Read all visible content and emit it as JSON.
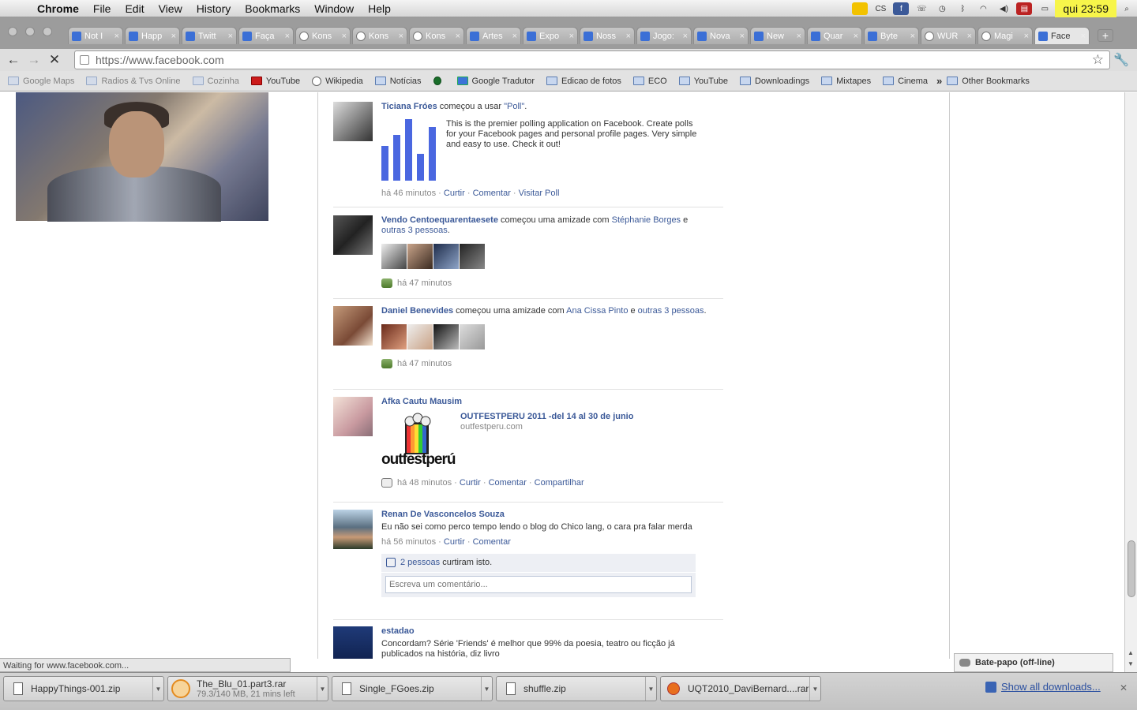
{
  "menubar": {
    "app": "Chrome",
    "items": [
      "File",
      "Edit",
      "View",
      "History",
      "Bookmarks",
      "Window",
      "Help"
    ],
    "tray_cs": "CS",
    "clock": "qui 23:59"
  },
  "tabs": [
    {
      "label": "Not I"
    },
    {
      "label": "Happ"
    },
    {
      "label": "Twitt"
    },
    {
      "label": "Faça"
    },
    {
      "label": "Kons"
    },
    {
      "label": "Kons"
    },
    {
      "label": "Kons"
    },
    {
      "label": "Artes"
    },
    {
      "label": "Expo"
    },
    {
      "label": "Noss"
    },
    {
      "label": "Jogo:"
    },
    {
      "label": "Nova"
    },
    {
      "label": "New"
    },
    {
      "label": "Quar"
    },
    {
      "label": "Byte"
    },
    {
      "label": "WUR"
    },
    {
      "label": "Magi"
    },
    {
      "label": "Face"
    }
  ],
  "address": "https://www.facebook.com",
  "bookmarks": [
    {
      "label": "Google Maps",
      "icon": "folder-icon"
    },
    {
      "label": "Radios & Tvs Online",
      "icon": "folder-icon"
    },
    {
      "label": "Cozinha",
      "icon": "folder-icon"
    },
    {
      "label": "YouTube",
      "icon": "youtube-icon"
    },
    {
      "label": "Wikipedia",
      "icon": "wikipedia-icon"
    },
    {
      "label": "Notícias",
      "icon": "folder-icon"
    },
    {
      "label": "",
      "icon": "spinner-icon"
    },
    {
      "label": "Google Tradutor",
      "icon": "translate-icon"
    },
    {
      "label": "Edicao de fotos",
      "icon": "folder-icon"
    },
    {
      "label": "ECO",
      "icon": "folder-icon"
    },
    {
      "label": "YouTube",
      "icon": "folder-icon"
    },
    {
      "label": "Downloadings",
      "icon": "folder-icon"
    },
    {
      "label": "Mixtapes",
      "icon": "folder-icon"
    },
    {
      "label": "Cinema",
      "icon": "folder-icon"
    }
  ],
  "other_bookmarks": "Other Bookmarks",
  "feed": {
    "s1": {
      "name": "Ticiana Fróes",
      "action": " começou a usar ",
      "app": "\"Poll\"",
      "desc": "This is the premier polling application on Facebook. Create polls for your Facebook pages and personal profile pages. Very simple and easy to use. Check it out!",
      "time": "há 46 minutos",
      "curtir": "Curtir",
      "comentar": "Comentar",
      "extra": "Visitar Poll",
      "sep": " · "
    },
    "s2": {
      "name": "Vendo Centoequarentaesete",
      "action": " começou uma amizade com ",
      "friend": "Stéphanie Borges",
      "and": " e ",
      "others": "outras 3 pessoas",
      "dot": ".",
      "time": "há 47 minutos"
    },
    "s3": {
      "name": "Daniel Benevides",
      "action": " começou uma amizade com ",
      "friend": "Ana Cissa Pinto",
      "and": " e ",
      "others": "outras 3 pessoas",
      "dot": ".",
      "time": "há 47 minutos"
    },
    "s4": {
      "name": "Afka Cautu Mausim",
      "link_title": "OUTFESTPERU 2011 -del 14 al 30 de junio",
      "link_domain": "outfestperu.com",
      "logo_text": "outfestperú",
      "time": "há 48 minutos",
      "curtir": "Curtir",
      "comentar": "Comentar",
      "share": "Compartilhar"
    },
    "s5": {
      "name": "Renan De Vasconcelos Souza",
      "text": "Eu não sei como perco tempo lendo o blog do Chico lang, o cara pra falar merda",
      "time": "há 56 minutos",
      "curtir": "Curtir",
      "comentar": "Comentar",
      "likes": "2 pessoas",
      "likes_suffix": " curtiram isto.",
      "comment_placeholder": "Escreva um comentário..."
    },
    "s6": {
      "name": "estadao",
      "text": "Concordam? Série 'Friends' é melhor que 99% da poesia, teatro ou ficção já publicados na história, diz livro"
    }
  },
  "chat": "Bate-papo (off-line)",
  "status": "Waiting for www.facebook.com...",
  "downloads": [
    {
      "name": "HappyThings-001.zip",
      "sub": ""
    },
    {
      "name": "The_Blu_01.part3.rar",
      "sub": "79.3/140 MB, 21 mins left"
    },
    {
      "name": "Single_FGoes.zip",
      "sub": ""
    },
    {
      "name": "shuffle.zip",
      "sub": ""
    },
    {
      "name": "UQT2010_DaviBernard....rar",
      "sub": ""
    }
  ],
  "show_all": "Show all downloads..."
}
